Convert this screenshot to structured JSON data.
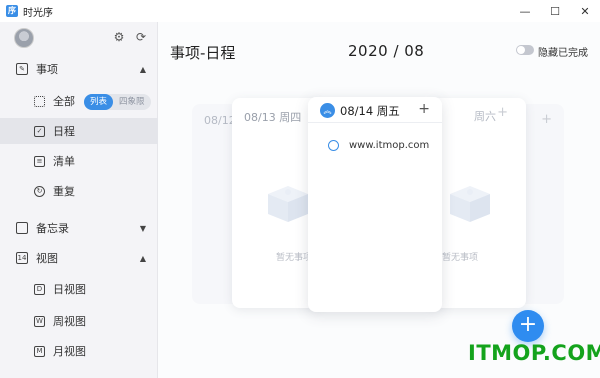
{
  "app": {
    "title": "时光序",
    "icon_text": "序"
  },
  "window": {
    "min_icon": "minimize-icon",
    "max_icon": "maximize-icon",
    "close_icon": "close-icon"
  },
  "sidebar": {
    "settings_icon": "gear-icon",
    "sync_icon": "refresh-icon",
    "groups": [
      {
        "label": "事项",
        "expanded": true
      },
      {
        "label": "备忘录",
        "expanded": false
      },
      {
        "label": "视图",
        "icon_text": "14",
        "expanded": true
      }
    ],
    "items": [
      {
        "label": "全部"
      },
      {
        "label": "日程",
        "active": true
      },
      {
        "label": "清单"
      },
      {
        "label": "重复"
      },
      {
        "label": "日视图",
        "icon_text": "D"
      },
      {
        "label": "周视图",
        "icon_text": "W"
      },
      {
        "label": "月视图",
        "icon_text": "M"
      }
    ],
    "view_toggle": {
      "options": [
        "列表",
        "四象限"
      ],
      "selected": "列表"
    }
  },
  "main": {
    "title": "事项-日程",
    "month": "2020 / 08",
    "hide_completed_label": "隐藏已完成",
    "hide_completed": false,
    "cards": [
      {
        "date": "08/12"
      },
      {
        "date": "08/13 周四",
        "empty_text": "暂无事项"
      },
      {
        "date": "周六",
        "empty_text": "暂无事项"
      }
    ],
    "active_card": {
      "date": "08/14 周五",
      "tasks": [
        {
          "text": "www.itmop.com",
          "done": false
        }
      ]
    },
    "add_button": "+"
  },
  "watermark": "ITMOP.COM",
  "colors": {
    "accent": "#3a8ee6",
    "watermark": "#14a31c"
  }
}
